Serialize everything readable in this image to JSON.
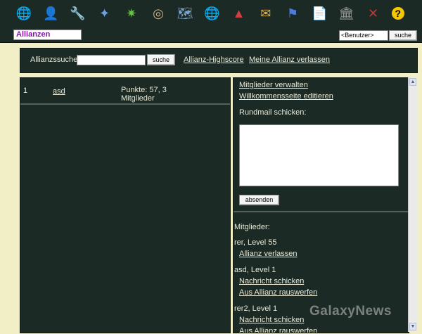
{
  "nav_icons": [
    {
      "name": "planet-icon",
      "glyph": "🌐"
    },
    {
      "name": "commander-icon",
      "glyph": "👤"
    },
    {
      "name": "research-tools-icon",
      "glyph": "🔧"
    },
    {
      "name": "fleet-icon",
      "glyph": "✦"
    },
    {
      "name": "defense-icon",
      "glyph": "✷"
    },
    {
      "name": "resources-icon",
      "glyph": "◎"
    },
    {
      "name": "galaxy-map-icon",
      "glyph": "🗺"
    },
    {
      "name": "universe-icon",
      "glyph": "🌐"
    },
    {
      "name": "shipyard-icon",
      "glyph": "▲"
    },
    {
      "name": "messages-icon",
      "glyph": "✉"
    },
    {
      "name": "alliance-icon",
      "glyph": "⚑"
    },
    {
      "name": "notes-icon",
      "glyph": "📄"
    },
    {
      "name": "bank-icon",
      "glyph": "🏛"
    },
    {
      "name": "logout-icon",
      "glyph": "✕"
    },
    {
      "name": "help-icon",
      "glyph": "?"
    }
  ],
  "header": {
    "page_title": "Allianzen",
    "user_select_value": "<Benutzer>",
    "search_button": "suche"
  },
  "alliance_search": {
    "label": "Allianzssuche:",
    "input_value": "",
    "button": "suche",
    "highscore_link": "Allianz-Highscore",
    "leave_link": "Meine Allianz verlassen"
  },
  "alliances": [
    {
      "rank": "1",
      "name": "asd",
      "points_line1": "Punkte: 57, 3",
      "points_line2": "Mitglieder"
    }
  ],
  "admin": {
    "manage_members": "Mitglieder verwalten",
    "edit_welcome": "Willkommensseite editieren",
    "rundmail_label": "Rundmail schicken:",
    "rundmail_value": "",
    "send_button": "absenden"
  },
  "members_section": {
    "title": "Mitglieder:",
    "members": [
      {
        "name_level": "rer, Level 55",
        "actions": [
          "Allianz verlassen"
        ]
      },
      {
        "name_level": "asd, Level 1",
        "actions": [
          "Nachricht schicken",
          "Aus Allianz rauswerfen"
        ]
      },
      {
        "name_level": "rer2, Level 1",
        "actions": [
          "Nachricht schicken",
          "Aus Allianz rauswerfen"
        ]
      }
    ]
  },
  "watermark": "GalaxyNews"
}
